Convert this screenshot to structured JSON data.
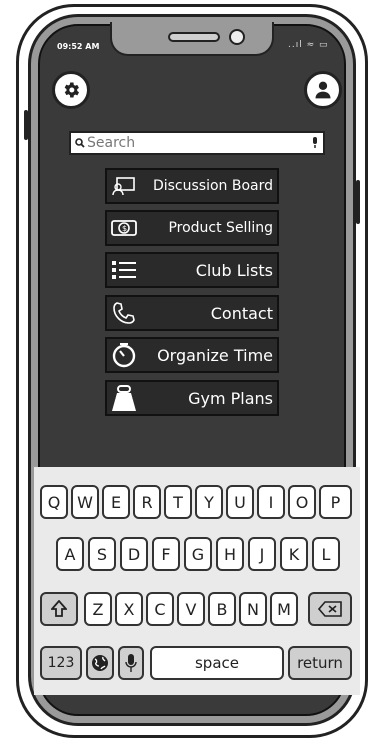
{
  "status_bar": {
    "time": "09:52 AM",
    "signal_wifi_battery": "..ıl ≈ ▭"
  },
  "search": {
    "placeholder": "Search"
  },
  "menu": [
    {
      "label": "Discussion Board",
      "icon": "chat-screen-icon"
    },
    {
      "label": "Product Selling",
      "icon": "money-icon"
    },
    {
      "label": "Club Lists",
      "icon": "list-icon"
    },
    {
      "label": "Contact",
      "icon": "phone-icon"
    },
    {
      "label": "Organize Time",
      "icon": "timer-icon"
    },
    {
      "label": "Gym Plans",
      "icon": "weight-icon"
    }
  ],
  "keyboard": {
    "row1": [
      "Q",
      "W",
      "E",
      "R",
      "T",
      "Y",
      "U",
      "I",
      "O",
      "P"
    ],
    "row2": [
      "A",
      "S",
      "D",
      "F",
      "G",
      "H",
      "J",
      "K",
      "L"
    ],
    "row3": [
      "Z",
      "X",
      "C",
      "V",
      "B",
      "N",
      "M"
    ],
    "numbers_key": "123",
    "space_key": "space",
    "return_key": "return"
  },
  "colors": {
    "screen": "#3a3a3a",
    "menu_button": "#2a2a2a",
    "keyboard": "#eaeaea",
    "frame": "#9a9a9a"
  }
}
